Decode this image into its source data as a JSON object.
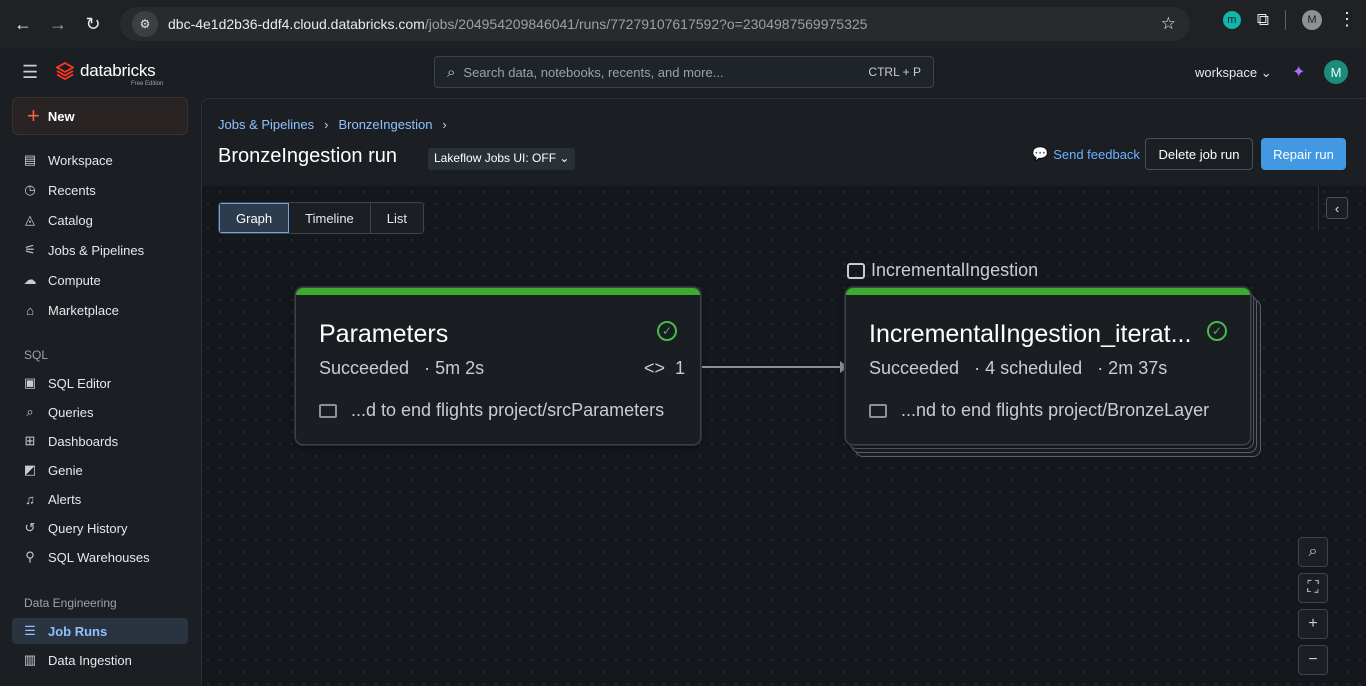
{
  "browser": {
    "url_host": "dbc-4e1d2b36-ddf4.cloud.databricks.com",
    "url_path": "/jobs/204954209846041/runs/772791076175​92?o=2304987569975325",
    "profile_initial": "M",
    "extension_initial": "m"
  },
  "header": {
    "brand": "databricks",
    "edition": "Free Edition",
    "search_placeholder": "Search data, notebooks, recents, and more...",
    "search_shortcut": "CTRL + P",
    "workspace_label": "workspace",
    "user_initial": "M"
  },
  "sidebar": {
    "new_label": "New",
    "items": [
      {
        "label": "Workspace",
        "icon": "workspace-icon"
      },
      {
        "label": "Recents",
        "icon": "clock-icon"
      },
      {
        "label": "Catalog",
        "icon": "catalog-icon"
      },
      {
        "label": "Jobs & Pipelines",
        "icon": "workflow-icon"
      },
      {
        "label": "Compute",
        "icon": "cloud-icon"
      },
      {
        "label": "Marketplace",
        "icon": "store-icon"
      }
    ],
    "sql_section": "SQL",
    "sql_items": [
      {
        "label": "SQL Editor",
        "icon": "sql-editor-icon"
      },
      {
        "label": "Queries",
        "icon": "query-icon"
      },
      {
        "label": "Dashboards",
        "icon": "dashboard-icon"
      },
      {
        "label": "Genie",
        "icon": "genie-icon"
      },
      {
        "label": "Alerts",
        "icon": "bell-icon"
      },
      {
        "label": "Query History",
        "icon": "history-icon"
      },
      {
        "label": "SQL Warehouses",
        "icon": "warehouse-icon"
      }
    ],
    "de_section": "Data Engineering",
    "de_items": [
      {
        "label": "Job Runs",
        "icon": "job-runs-icon",
        "active": true
      },
      {
        "label": "Data Ingestion",
        "icon": "ingestion-icon"
      }
    ]
  },
  "main": {
    "breadcrumbs": [
      "Jobs & Pipelines",
      "BronzeIngestion"
    ],
    "title": "BronzeIngestion run",
    "lakeflow_toggle": "Lakeflow Jobs UI: OFF",
    "feedback": "Send feedback",
    "delete_label": "Delete job run",
    "repair_label": "Repair run",
    "view_tabs": [
      "Graph",
      "Timeline",
      "List"
    ],
    "active_tab": "Graph"
  },
  "graph": {
    "group_label": "IncrementalIngestion",
    "nodes": [
      {
        "title": "Parameters",
        "status": "Succeeded",
        "duration": "· 5m 2s",
        "code_count": "1",
        "path": "...d to end flights project/srcParameters"
      },
      {
        "title": "IncrementalIngestion_iterat...",
        "status": "Succeeded",
        "scheduled": "· 4 scheduled",
        "duration": "· 2m 37s",
        "path": "...nd to end flights project/BronzeLayer"
      }
    ]
  },
  "colors": {
    "accent": "#4299e1",
    "success": "#3cab2e",
    "link": "#8fc1ff",
    "brand": "#ff3621"
  }
}
